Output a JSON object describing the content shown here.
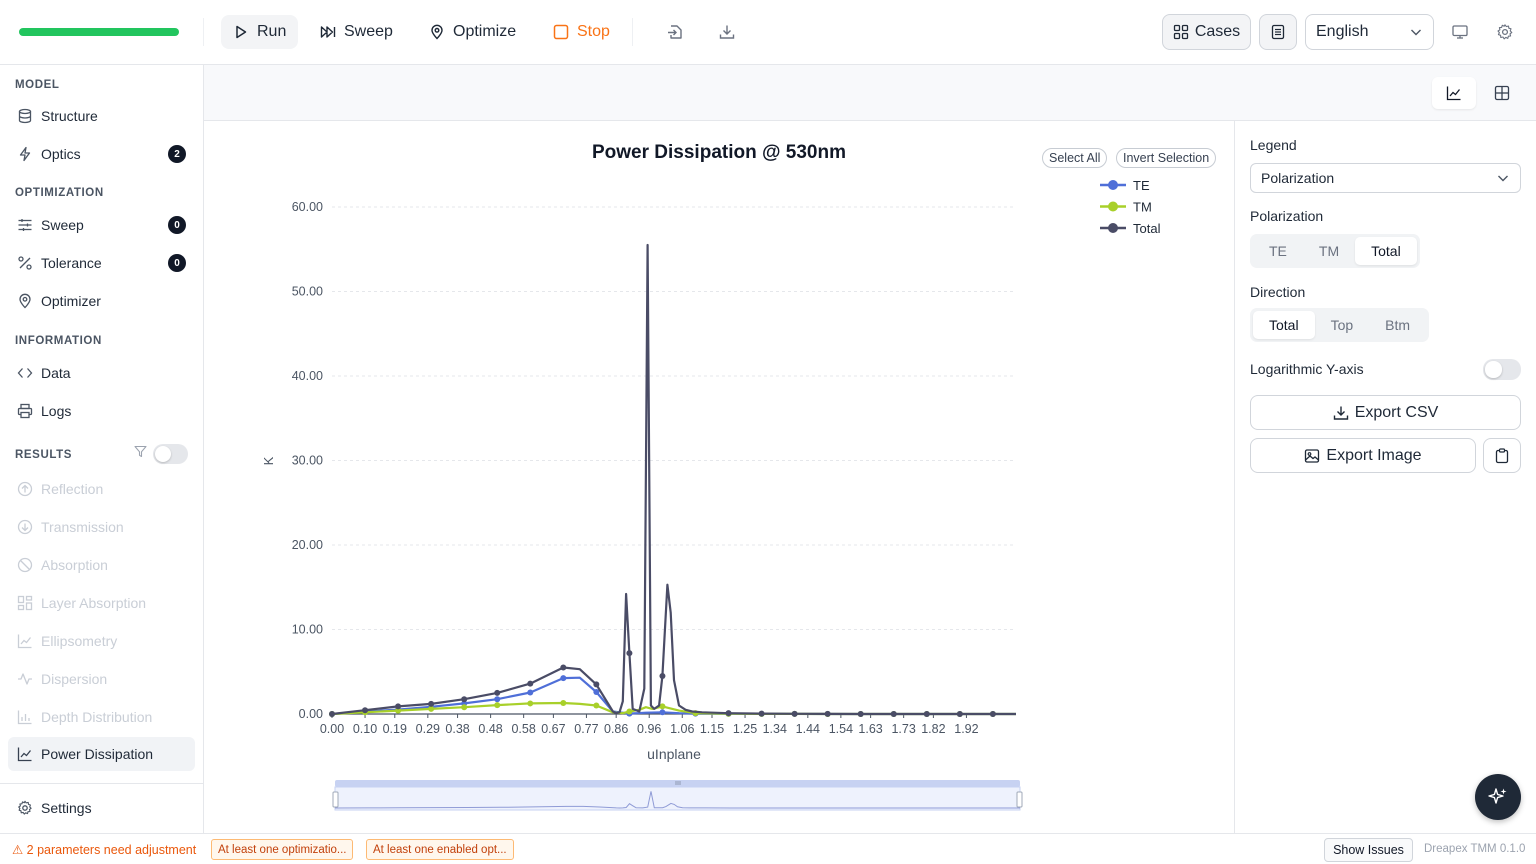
{
  "toolbar": {
    "progress": 1.0,
    "run_label": "Run",
    "sweep_label": "Sweep",
    "optimize_label": "Optimize",
    "stop_label": "Stop",
    "cases_label": "Cases",
    "language": "English"
  },
  "sidebar": {
    "model_title": "MODEL",
    "structure_label": "Structure",
    "optics_label": "Optics",
    "optics_badge": "2",
    "optimization_title": "OPTIMIZATION",
    "sweep_label": "Sweep",
    "sweep_badge": "0",
    "tolerance_label": "Tolerance",
    "tolerance_badge": "0",
    "optimizer_label": "Optimizer",
    "information_title": "INFORMATION",
    "data_label": "Data",
    "logs_label": "Logs",
    "results_title": "RESULTS",
    "results": [
      "Reflection",
      "Transmission",
      "Absorption",
      "Layer Absorption",
      "Ellipsometry",
      "Dispersion",
      "Depth Distribution",
      "Power Dissipation"
    ],
    "settings_label": "Settings"
  },
  "chart_controls": {
    "select_all": "Select All",
    "invert_selection": "Invert Selection"
  },
  "right_panel": {
    "legend_label": "Legend",
    "legend_value": "Polarization",
    "polarization_label": "Polarization",
    "polarization_options": [
      "TE",
      "TM",
      "Total"
    ],
    "polarization_selected": "Total",
    "direction_label": "Direction",
    "direction_options": [
      "Total",
      "Top",
      "Btm"
    ],
    "direction_selected": "Total",
    "log_label": "Logarithmic Y-axis",
    "log_enabled": false,
    "export_csv": "Export CSV",
    "export_image": "Export Image"
  },
  "statusbar": {
    "warning": "⚠ 2 parameters need adjustment",
    "chip1": "At least one optimizatio...",
    "chip2": "At least one enabled opt...",
    "show_issues": "Show Issues",
    "version": "Dreapex TMM 0.1.0"
  },
  "chart_data": {
    "type": "line",
    "title": "Power Dissipation @ 530nm",
    "xlabel": "uInplane",
    "ylabel": "K",
    "ylim": [
      0,
      60
    ],
    "xlim": [
      0,
      2.07
    ],
    "yticks": [
      "0.00",
      "10.00",
      "20.00",
      "30.00",
      "40.00",
      "50.00",
      "60.00"
    ],
    "xticks": [
      "0.00",
      "0.10",
      "0.19",
      "0.29",
      "0.38",
      "0.48",
      "0.58",
      "0.67",
      "0.77",
      "0.86",
      "0.96",
      "1.06",
      "1.15",
      "1.25",
      "1.34",
      "1.44",
      "1.54",
      "1.63",
      "1.73",
      "1.82",
      "1.92"
    ],
    "grid": true,
    "legend_position": "top-right",
    "series": [
      {
        "name": "TE",
        "color": "#4f6fd8",
        "x": [
          0.0,
          0.1,
          0.2,
          0.3,
          0.4,
          0.5,
          0.6,
          0.7,
          0.75,
          0.8,
          0.85,
          0.9,
          0.95,
          1.0,
          1.05,
          1.1,
          1.2,
          1.3,
          1.4,
          1.5,
          1.6,
          1.7,
          1.8,
          1.9,
          2.0,
          2.07
        ],
        "y": [
          0.0,
          0.28,
          0.52,
          0.85,
          1.25,
          1.75,
          2.55,
          4.25,
          4.3,
          2.6,
          0.3,
          0.05,
          0.15,
          0.2,
          0.1,
          0.05,
          0.02,
          0.01,
          0.01,
          0.0,
          0.0,
          0.0,
          0.0,
          0.0,
          0.0,
          0.0
        ]
      },
      {
        "name": "TM",
        "color": "#a8d02a",
        "x": [
          0.0,
          0.1,
          0.2,
          0.3,
          0.4,
          0.5,
          0.6,
          0.7,
          0.75,
          0.8,
          0.85,
          0.88,
          0.9,
          0.93,
          0.95,
          0.97,
          1.0,
          1.05,
          1.1,
          1.2,
          1.3,
          1.4,
          1.5,
          1.6,
          1.7,
          1.8,
          1.9,
          2.0,
          2.07
        ],
        "y": [
          0.0,
          0.2,
          0.4,
          0.6,
          0.8,
          1.05,
          1.25,
          1.3,
          1.2,
          1.0,
          0.2,
          0.1,
          0.3,
          0.5,
          0.8,
          0.6,
          0.9,
          0.4,
          0.1,
          0.03,
          0.01,
          0.01,
          0.0,
          0.0,
          0.0,
          0.0,
          0.0,
          0.0,
          0.0
        ]
      },
      {
        "name": "Total",
        "color": "#4a4c66",
        "x": [
          0.0,
          0.1,
          0.2,
          0.3,
          0.4,
          0.5,
          0.6,
          0.7,
          0.75,
          0.8,
          0.85,
          0.86,
          0.87,
          0.88,
          0.89,
          0.9,
          0.91,
          0.93,
          0.945,
          0.955,
          0.965,
          0.975,
          0.99,
          1.0,
          1.015,
          1.025,
          1.035,
          1.05,
          1.07,
          1.09,
          1.12,
          1.2,
          1.3,
          1.4,
          1.5,
          1.6,
          1.7,
          1.8,
          1.9,
          2.0,
          2.07
        ],
        "y": [
          0.0,
          0.45,
          0.9,
          1.2,
          1.75,
          2.5,
          3.6,
          5.5,
          5.3,
          3.5,
          0.3,
          0.1,
          0.2,
          1.5,
          14.2,
          7.2,
          0.6,
          0.3,
          3.0,
          55.5,
          1.0,
          0.6,
          1.0,
          4.5,
          15.3,
          12.0,
          4.0,
          1.0,
          0.5,
          0.3,
          0.2,
          0.1,
          0.05,
          0.02,
          0.01,
          0.0,
          0.0,
          0.0,
          0.0,
          0.0,
          0.0
        ]
      }
    ]
  }
}
